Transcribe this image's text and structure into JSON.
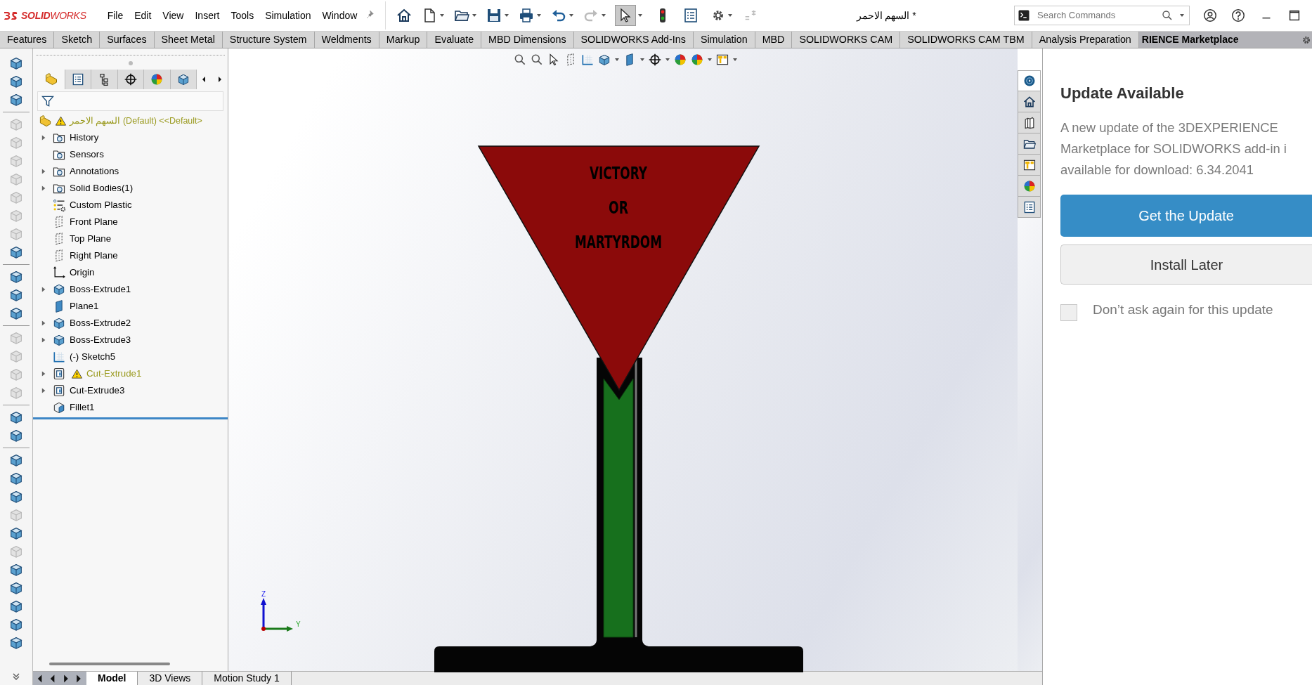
{
  "app": {
    "logo": "**SOLID**WORKS",
    "menus": [
      "File",
      "Edit",
      "View",
      "Insert",
      "Tools",
      "Simulation",
      "Window"
    ],
    "document_title": "السهم الاحمر *",
    "search": {
      "placeholder": "Search Commands"
    }
  },
  "command_tabs": [
    "Features",
    "Sketch",
    "Surfaces",
    "Sheet Metal",
    "Structure System",
    "Weldments",
    "Markup",
    "Evaluate",
    "MBD Dimensions",
    "SOLIDWORKS Add-Ins",
    "Simulation",
    "MBD",
    "SOLIDWORKS CAM",
    "SOLIDWORKS CAM TBM",
    "Analysis Preparation"
  ],
  "task_pane_header": "RIENCE Marketplace",
  "command_bar": [
    {
      "tools": [
        {
          "disabled": false
        },
        {
          "disabled": false
        },
        {
          "disabled": false
        }
      ]
    },
    {
      "tools": [
        {
          "disabled": true
        },
        {
          "disabled": true
        },
        {
          "disabled": true
        },
        {
          "disabled": true
        },
        {
          "disabled": true
        },
        {
          "disabled": true
        },
        {
          "disabled": true
        },
        {
          "disabled": false
        }
      ]
    },
    {
      "tools": [
        {
          "disabled": false
        },
        {
          "disabled": false
        },
        {
          "disabled": false
        }
      ]
    },
    {
      "tools": [
        {
          "disabled": true
        },
        {
          "disabled": true
        },
        {
          "disabled": true
        },
        {
          "disabled": true
        }
      ]
    },
    {
      "tools": [
        {
          "disabled": false
        },
        {
          "disabled": false
        }
      ]
    },
    {
      "tools": [
        {
          "disabled": false
        },
        {
          "disabled": false
        },
        {
          "disabled": false
        },
        {
          "disabled": true
        },
        {
          "disabled": false
        },
        {
          "disabled": true
        },
        {
          "disabled": false
        },
        {
          "disabled": false
        },
        {
          "disabled": false
        },
        {
          "disabled": false
        },
        {
          "disabled": false
        }
      ]
    }
  ],
  "feature_manager": {
    "tabs": [
      {
        "selected": true
      },
      {
        "selected": false
      },
      {
        "selected": false
      },
      {
        "selected": false
      },
      {
        "selected": false
      },
      {
        "selected": false
      }
    ],
    "root": {
      "label": "السهم الاحمر (Default) <<Default>",
      "warning": true
    },
    "items": [
      {
        "label": "History",
        "kind": "folder",
        "expandable": true,
        "warning": false
      },
      {
        "label": "Sensors",
        "kind": "folder",
        "expandable": false,
        "warning": false
      },
      {
        "label": "Annotations",
        "kind": "folder",
        "expandable": true,
        "warning": false
      },
      {
        "label": "Solid Bodies(1)",
        "kind": "folder",
        "expandable": true,
        "warning": false
      },
      {
        "label": "Custom Plastic",
        "kind": "material",
        "expandable": false,
        "warning": false
      },
      {
        "label": "Front Plane",
        "kind": "plane",
        "expandable": false,
        "warning": false
      },
      {
        "label": "Top Plane",
        "kind": "plane",
        "expandable": false,
        "warning": false
      },
      {
        "label": "Right Plane",
        "kind": "plane",
        "expandable": false,
        "warning": false
      },
      {
        "label": "Origin",
        "kind": "origin",
        "expandable": false,
        "warning": false
      },
      {
        "label": "Boss-Extrude1",
        "kind": "extrude",
        "expandable": true,
        "warning": false
      },
      {
        "label": "Plane1",
        "kind": "refplane",
        "expandable": false,
        "warning": false
      },
      {
        "label": "Boss-Extrude2",
        "kind": "extrude",
        "expandable": true,
        "warning": false
      },
      {
        "label": "Boss-Extrude3",
        "kind": "extrude",
        "expandable": true,
        "warning": false
      },
      {
        "label": "(-) Sketch5",
        "kind": "sketch",
        "expandable": false,
        "warning": false
      },
      {
        "label": "Cut-Extrude1",
        "kind": "cut",
        "expandable": true,
        "warning": true
      },
      {
        "label": "Cut-Extrude3",
        "kind": "cut",
        "expandable": true,
        "warning": false
      },
      {
        "label": "Fillet1",
        "kind": "fillet",
        "expandable": false,
        "warning": false
      }
    ]
  },
  "bottom_tabs": [
    {
      "label": "Model",
      "selected": true
    },
    {
      "label": "3D Views",
      "selected": false
    },
    {
      "label": "Motion Study 1",
      "selected": false
    }
  ],
  "model": {
    "text_lines": [
      "VICTORY",
      "OR",
      "MARTYRDOM"
    ],
    "triad": {
      "z": "Z",
      "y": "Y"
    }
  },
  "task_tabs": [
    {
      "selected": true
    },
    {
      "selected": false
    },
    {
      "selected": false
    },
    {
      "selected": false
    },
    {
      "selected": false
    },
    {
      "selected": false
    },
    {
      "selected": false
    }
  ],
  "update_panel": {
    "title": "Update Available",
    "message_lines": [
      "A new update of the 3DEXPERIENCE",
      "Marketplace for SOLIDWORKS add-in i",
      "available for download: 6.34.2041"
    ],
    "primary_button": "Get the Update",
    "secondary_button": "Install Later",
    "checkbox": {
      "label": "Don’t ask again for this update",
      "checked": false
    }
  }
}
